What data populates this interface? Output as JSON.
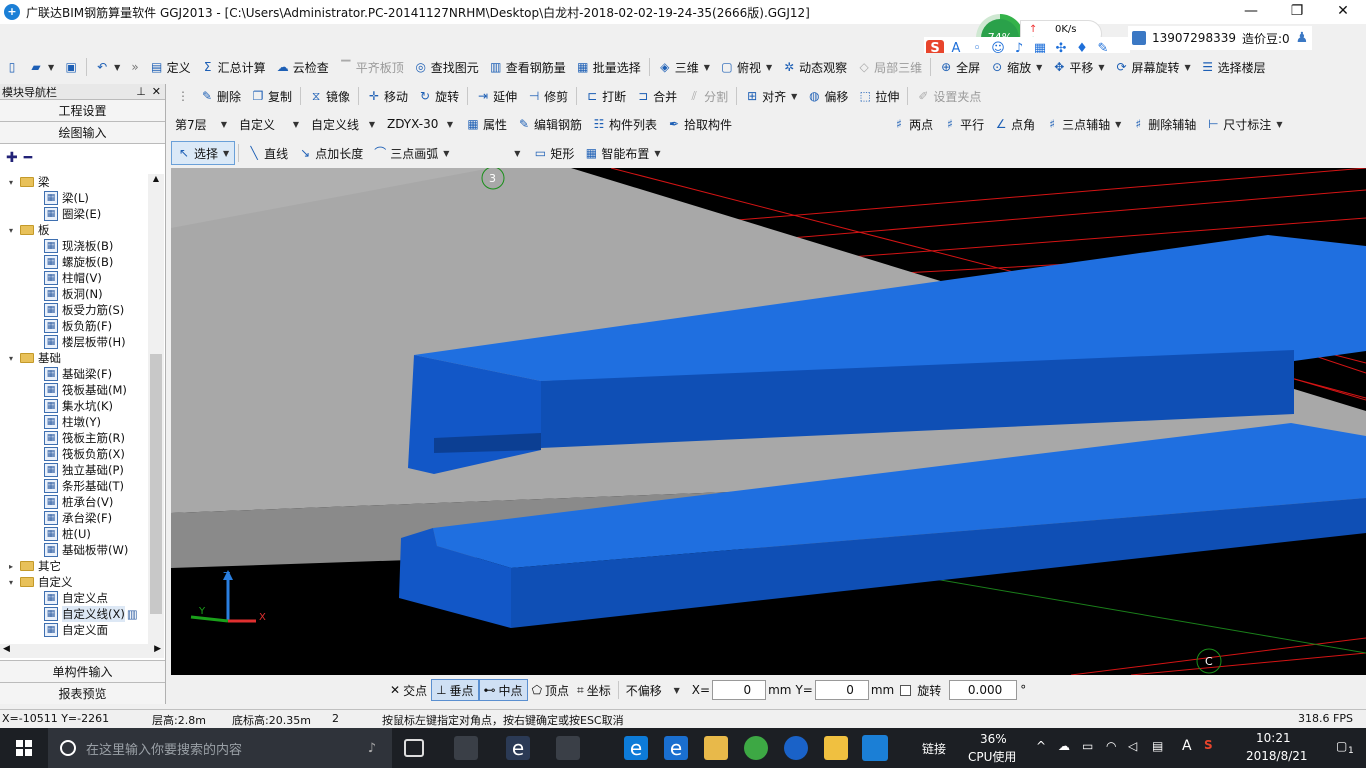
{
  "window": {
    "title": "广联达BIM钢筋算量软件 GGJ2013 - [C:\\Users\\Administrator.PC-20141127NRHM\\Desktop\\白龙村-2018-02-02-19-24-35(2666版).GGJ12]"
  },
  "overlay": {
    "cpu_percent": "74%",
    "net_speed": "0K/s",
    "user_phone": "13907298339",
    "points_label": "造价豆:0"
  },
  "toolbar1": [
    {
      "label": "定义",
      "icon": "define-icon"
    },
    {
      "label": "汇总计算",
      "icon": "sigma-icon"
    },
    {
      "label": "云检查",
      "icon": "cloud-check-icon"
    },
    {
      "label": "平齐板顶",
      "icon": "align-top-icon",
      "disabled": true
    },
    {
      "label": "查找图元",
      "icon": "binoculars-icon"
    },
    {
      "label": "查看钢筋量",
      "icon": "rebar-view-icon"
    },
    {
      "label": "批量选择",
      "icon": "batch-select-icon"
    },
    {
      "label": "三维",
      "icon": "cube-icon"
    },
    {
      "label": "俯视",
      "icon": "top-view-icon"
    },
    {
      "label": "动态观察",
      "icon": "orbit-icon"
    },
    {
      "label": "局部三维",
      "icon": "local-3d-icon",
      "disabled": true
    },
    {
      "label": "全屏",
      "icon": "fullscreen-icon"
    },
    {
      "label": "缩放",
      "icon": "zoom-icon"
    },
    {
      "label": "平移",
      "icon": "pan-icon"
    },
    {
      "label": "屏幕旋转",
      "icon": "screen-rotate-icon"
    },
    {
      "label": "选择楼层",
      "icon": "floor-select-icon"
    }
  ],
  "toolbar2": [
    {
      "label": "删除",
      "icon": "delete-icon"
    },
    {
      "label": "复制",
      "icon": "copy-icon"
    },
    {
      "label": "镜像",
      "icon": "mirror-icon"
    },
    {
      "label": "移动",
      "icon": "move-icon"
    },
    {
      "label": "旋转",
      "icon": "rotate-icon"
    },
    {
      "label": "延伸",
      "icon": "extend-icon"
    },
    {
      "label": "修剪",
      "icon": "trim-icon"
    },
    {
      "label": "打断",
      "icon": "break-icon"
    },
    {
      "label": "合并",
      "icon": "merge-icon"
    },
    {
      "label": "分割",
      "icon": "split-icon",
      "disabled": true
    },
    {
      "label": "对齐",
      "icon": "align-icon"
    },
    {
      "label": "偏移",
      "icon": "offset-icon"
    },
    {
      "label": "拉伸",
      "icon": "stretch-icon"
    },
    {
      "label": "设置夹点",
      "icon": "grip-point-icon",
      "disabled": true
    }
  ],
  "toolbar3": {
    "floor": "第7层",
    "category": "自定义",
    "type": "自定义线",
    "component": "ZDYX-30",
    "buttons": [
      {
        "label": "属性",
        "icon": "properties-icon"
      },
      {
        "label": "编辑钢筋",
        "icon": "edit-rebar-icon"
      },
      {
        "label": "构件列表",
        "icon": "component-list-icon"
      },
      {
        "label": "拾取构件",
        "icon": "pick-component-icon"
      }
    ],
    "axis_buttons": [
      {
        "label": "两点",
        "icon": "two-point-axis-icon"
      },
      {
        "label": "平行",
        "icon": "parallel-axis-icon"
      },
      {
        "label": "点角",
        "icon": "point-angle-icon"
      },
      {
        "label": "三点辅轴",
        "icon": "three-point-axis-icon"
      },
      {
        "label": "删除辅轴",
        "icon": "delete-axis-icon"
      },
      {
        "label": "尺寸标注",
        "icon": "dimension-icon"
      }
    ]
  },
  "toolbar4": [
    {
      "label": "选择",
      "icon": "cursor-icon"
    },
    {
      "label": "直线",
      "icon": "line-icon"
    },
    {
      "label": "点加长度",
      "icon": "point-length-icon"
    },
    {
      "label": "三点画弧",
      "icon": "arc-icon"
    },
    {
      "label": "矩形",
      "icon": "rectangle-icon"
    },
    {
      "label": "智能布置",
      "icon": "smart-layout-icon"
    }
  ],
  "nav": {
    "header": "模块导航栏",
    "tab1": "工程设置",
    "tab2": "绘图输入",
    "bottom1": "单构件输入",
    "bottom2": "报表预览",
    "tree": [
      {
        "label": "梁",
        "level": 0,
        "open": true
      },
      {
        "label": "梁(L)",
        "level": 1
      },
      {
        "label": "圈梁(E)",
        "level": 1
      },
      {
        "label": "板",
        "level": 0,
        "open": true
      },
      {
        "label": "现浇板(B)",
        "level": 1
      },
      {
        "label": "螺旋板(B)",
        "level": 1
      },
      {
        "label": "柱帽(V)",
        "level": 1
      },
      {
        "label": "板洞(N)",
        "level": 1
      },
      {
        "label": "板受力筋(S)",
        "level": 1
      },
      {
        "label": "板负筋(F)",
        "level": 1
      },
      {
        "label": "楼层板带(H)",
        "level": 1
      },
      {
        "label": "基础",
        "level": 0,
        "open": true
      },
      {
        "label": "基础梁(F)",
        "level": 1
      },
      {
        "label": "筏板基础(M)",
        "level": 1
      },
      {
        "label": "集水坑(K)",
        "level": 1
      },
      {
        "label": "柱墩(Y)",
        "level": 1
      },
      {
        "label": "筏板主筋(R)",
        "level": 1
      },
      {
        "label": "筏板负筋(X)",
        "level": 1
      },
      {
        "label": "独立基础(P)",
        "level": 1
      },
      {
        "label": "条形基础(T)",
        "level": 1
      },
      {
        "label": "桩承台(V)",
        "level": 1
      },
      {
        "label": "承台梁(F)",
        "level": 1
      },
      {
        "label": "桩(U)",
        "level": 1
      },
      {
        "label": "基础板带(W)",
        "level": 1
      },
      {
        "label": "其它",
        "level": 0,
        "open": false
      },
      {
        "label": "自定义",
        "level": 0,
        "open": true
      },
      {
        "label": "自定义点",
        "level": 1
      },
      {
        "label": "自定义线(X)",
        "level": 1,
        "selected": true
      },
      {
        "label": "自定义面",
        "level": 1
      }
    ]
  },
  "viewport": {
    "axis_labels": [
      "3",
      "C"
    ],
    "axes": [
      "Z",
      "X",
      "Y"
    ],
    "colors": {
      "background": "#000000",
      "blue": "#1565d8",
      "gray": "#9c9c9c",
      "grid": "#d01010"
    }
  },
  "snap": {
    "buttons": [
      {
        "label": "交点",
        "icon": "intersection-icon",
        "on": false
      },
      {
        "label": "垂点",
        "icon": "perpendicular-icon",
        "on": true
      },
      {
        "label": "中点",
        "icon": "midpoint-icon",
        "on": true
      },
      {
        "label": "顶点",
        "icon": "vertex-icon",
        "on": false
      },
      {
        "label": "坐标",
        "icon": "coordinate-icon",
        "on": false
      }
    ],
    "offset_mode": "不偏移",
    "x_label": "X=",
    "x_value": "0",
    "y_label": "Y=",
    "y_value": "0",
    "unit": "mm",
    "rotate_label": "旋转",
    "rotate_value": "0.000",
    "degree": "°"
  },
  "status": {
    "coords": "X=-10511 Y=-2261",
    "floor_height": "层高:2.8m",
    "base_height": "底标高:20.35m",
    "count": "2",
    "hint": "按鼠标左键指定对角点，按右键确定或按ESC取消",
    "fps": "318.6 FPS"
  },
  "taskbar": {
    "search_placeholder": "在这里输入你要搜索的内容",
    "link": "链接",
    "cpu_percent": "36%",
    "cpu_label": "CPU使用",
    "ime": "A",
    "time": "10:21",
    "date": "2018/8/21",
    "notif_count": "1"
  }
}
